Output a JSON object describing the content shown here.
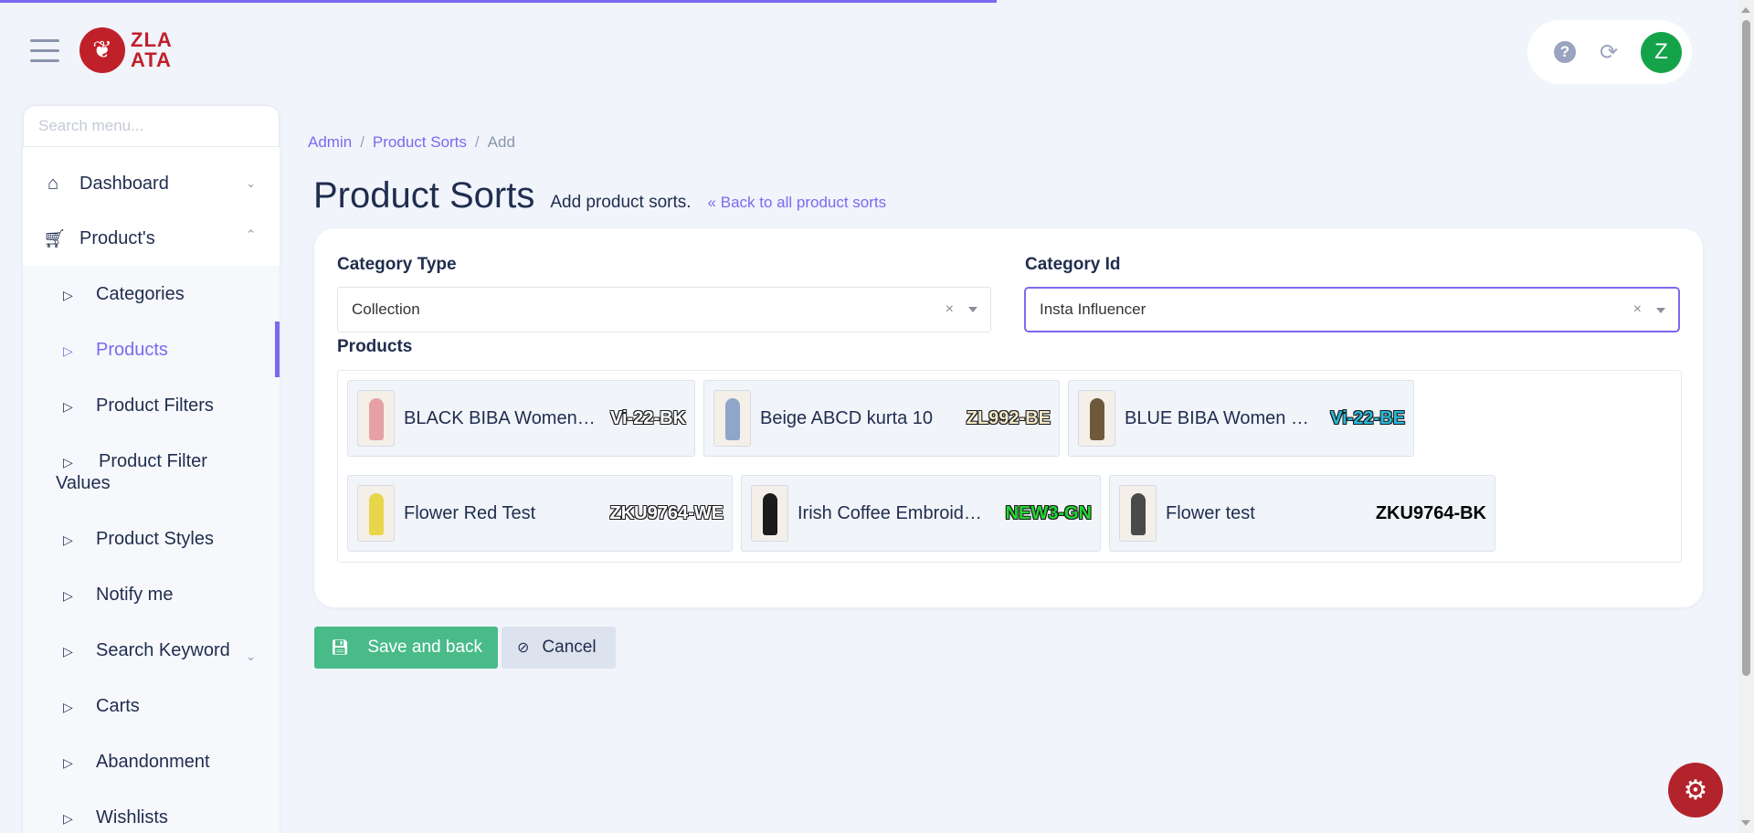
{
  "header": {
    "logo_line1": "ZLA",
    "logo_line2": "ATA",
    "avatar_letter": "Z",
    "progress_fraction": 0.568
  },
  "sidebar": {
    "search_placeholder": "Search menu...",
    "dashboard": "Dashboard",
    "products_section": "Product's",
    "items": [
      {
        "label": "Categories"
      },
      {
        "label": "Products"
      },
      {
        "label": "Product Filters"
      },
      {
        "label": "Product Filter Values"
      },
      {
        "label": "Product Styles"
      },
      {
        "label": "Notify me"
      },
      {
        "label": "Search Keyword"
      },
      {
        "label": "Carts"
      },
      {
        "label": "Abandonment"
      },
      {
        "label": "Wishlists"
      }
    ]
  },
  "breadcrumb": {
    "admin": "Admin",
    "product_sorts": "Product Sorts",
    "current": "Add",
    "sep": "/"
  },
  "page": {
    "title": "Product Sorts",
    "subtitle": "Add product sorts.",
    "back_link": "Back to all product sorts"
  },
  "form": {
    "category_type_label": "Category Type",
    "category_type_value": "Collection",
    "category_id_label": "Category Id",
    "category_id_value": "Insta Influencer",
    "products_label": "Products",
    "clear_glyph": "×",
    "products": [
      {
        "name": "BLACK BIBA Women…",
        "sku": "Vi-22-BK",
        "sku_color": "#ffffff",
        "thumb_color": "#e7a0a6"
      },
      {
        "name": "Beige ABCD kurta 10",
        "sku": "ZL992-BE",
        "sku_color": "#f1e6c8",
        "thumb_color": "#8fa6c8"
      },
      {
        "name": "BLUE BIBA Women …",
        "sku": "Vi-22-BE",
        "sku_color": "#27b8d9",
        "thumb_color": "#6e5a3a"
      },
      {
        "name": "Flower Red Test",
        "sku": "ZKU9764-WE",
        "sku_color": "#ffffff",
        "thumb_color": "#e8d64a"
      },
      {
        "name": "Irish Coffee Embroid…",
        "sku": "NEW3-GN",
        "sku_color": "#22d632",
        "thumb_color": "#1c1c1c"
      },
      {
        "name": "Flower test",
        "sku": "ZKU9764-BK",
        "sku_color": "#000000",
        "thumb_color": "#4a4a4a"
      }
    ]
  },
  "buttons": {
    "save": "Save and back",
    "cancel": "Cancel"
  },
  "colors": {
    "accent": "#7c69ef",
    "save_green": "#48bb89",
    "brand_red": "#c0202a",
    "avatar_green": "#15a34a"
  }
}
